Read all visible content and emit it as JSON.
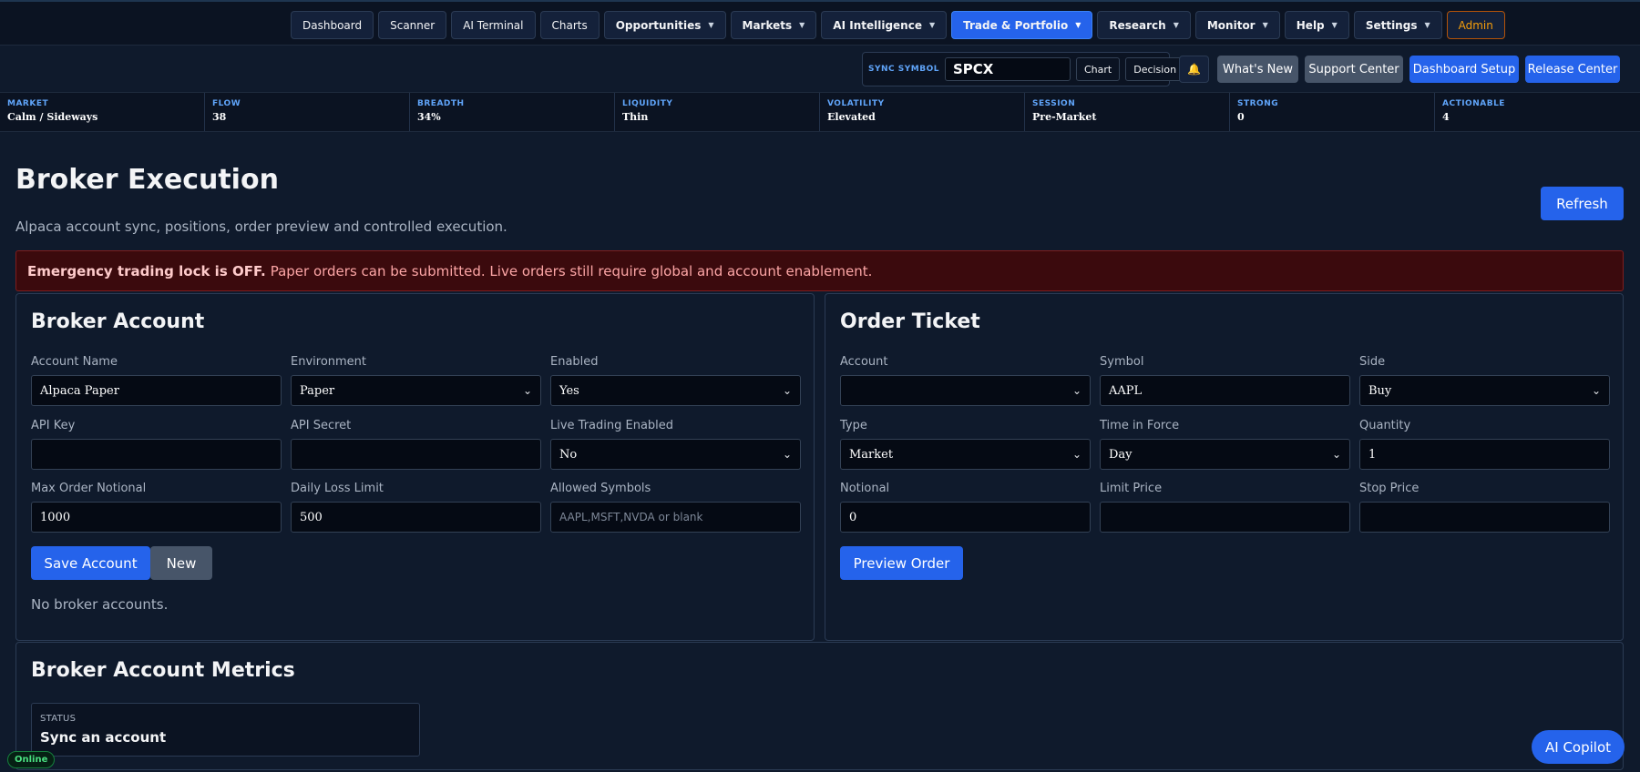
{
  "nav": {
    "items": [
      {
        "label": "Dashboard",
        "dropdown": false
      },
      {
        "label": "Scanner",
        "dropdown": false
      },
      {
        "label": "AI Terminal",
        "dropdown": false
      },
      {
        "label": "Charts",
        "dropdown": false
      },
      {
        "label": "Opportunities",
        "dropdown": true
      },
      {
        "label": "Markets",
        "dropdown": true
      },
      {
        "label": "AI Intelligence",
        "dropdown": true
      },
      {
        "label": "Trade & Portfolio",
        "dropdown": true,
        "active": true
      },
      {
        "label": "Research",
        "dropdown": true
      },
      {
        "label": "Monitor",
        "dropdown": true
      },
      {
        "label": "Help",
        "dropdown": true
      },
      {
        "label": "Settings",
        "dropdown": true
      },
      {
        "label": "Admin",
        "dropdown": false
      }
    ]
  },
  "sync": {
    "label": "SYNC SYMBOL",
    "symbol": "SPCX",
    "chart_label": "Chart",
    "decision_label": "Decision"
  },
  "header_actions": {
    "bell": "🔔",
    "whats_new": "What's New",
    "support_center": "Support Center",
    "dashboard_setup": "Dashboard Setup",
    "release_center": "Release Center"
  },
  "status": [
    {
      "key": "MARKET",
      "value": "Calm / Sideways"
    },
    {
      "key": "FLOW",
      "value": "38"
    },
    {
      "key": "BREADTH",
      "value": "34%"
    },
    {
      "key": "LIQUIDITY",
      "value": "Thin"
    },
    {
      "key": "VOLATILITY",
      "value": "Elevated"
    },
    {
      "key": "SESSION",
      "value": "Pre-Market"
    },
    {
      "key": "STRONG",
      "value": "0"
    },
    {
      "key": "ACTIONABLE",
      "value": "4"
    }
  ],
  "page": {
    "title": "Broker Execution",
    "subtitle": "Alpaca account sync, positions, order preview and controlled execution.",
    "refresh_label": "Refresh"
  },
  "alert": {
    "bold": "Emergency trading lock is OFF.",
    "text": "Paper orders can be submitted. Live orders still require global and account enablement."
  },
  "broker_account": {
    "title": "Broker Account",
    "account_name_label": "Account Name",
    "account_name_value": "Alpaca Paper",
    "environment_label": "Environment",
    "environment_value": "Paper",
    "enabled_label": "Enabled",
    "enabled_value": "Yes",
    "api_key_label": "API Key",
    "api_key_value": "",
    "api_secret_label": "API Secret",
    "api_secret_value": "",
    "live_trading_label": "Live Trading Enabled",
    "live_trading_value": "No",
    "max_notional_label": "Max Order Notional",
    "max_notional_value": "1000",
    "daily_loss_label": "Daily Loss Limit",
    "daily_loss_value": "500",
    "allowed_symbols_label": "Allowed Symbols",
    "allowed_symbols_placeholder": "AAPL,MSFT,NVDA or blank",
    "save_label": "Save Account",
    "new_label": "New",
    "empty_note": "No broker accounts."
  },
  "order_ticket": {
    "title": "Order Ticket",
    "account_label": "Account",
    "account_value": "",
    "symbol_label": "Symbol",
    "symbol_value": "AAPL",
    "side_label": "Side",
    "side_value": "Buy",
    "type_label": "Type",
    "type_value": "Market",
    "tif_label": "Time in Force",
    "tif_value": "Day",
    "quantity_label": "Quantity",
    "quantity_value": "1",
    "notional_label": "Notional",
    "notional_value": "0",
    "limit_label": "Limit Price",
    "limit_value": "",
    "stop_label": "Stop Price",
    "stop_value": "",
    "preview_label": "Preview Order"
  },
  "metrics": {
    "title": "Broker Account Metrics",
    "status_key": "STATUS",
    "status_value": "Sync an account"
  },
  "footer": {
    "online": "Online",
    "copilot": "AI Copilot"
  },
  "colors": {
    "accent": "#2563eb",
    "background": "#0f1a2c",
    "alert_bg": "#3b0a0d",
    "admin": "#f59e0b",
    "online": "#4ade80"
  }
}
